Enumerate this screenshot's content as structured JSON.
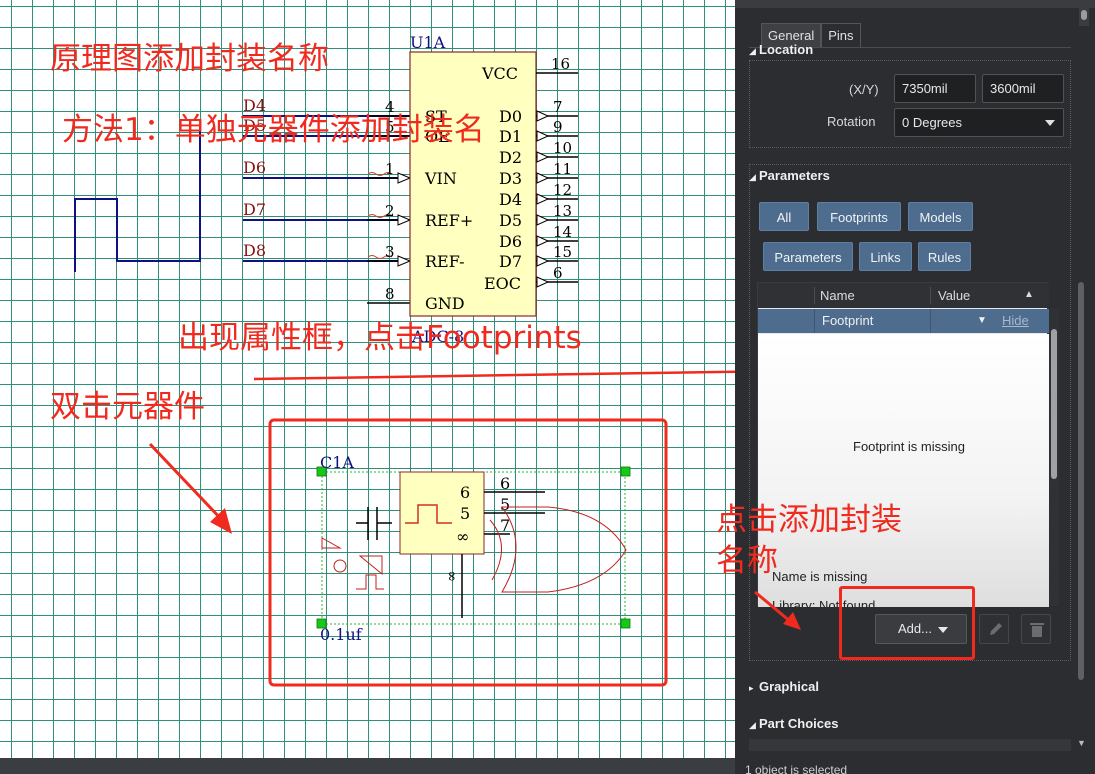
{
  "schematic": {
    "u1_designator": "U1A",
    "u1_comment": "ADC-8",
    "u1_left_pins": [
      {
        "name": "ST",
        "num": "4",
        "net": "D4"
      },
      {
        "name": "OE",
        "num": "5",
        "net": "D5"
      },
      {
        "name": "VIN",
        "num": "1",
        "net": "D6"
      },
      {
        "name": "REF+",
        "num": "2",
        "net": "D7"
      },
      {
        "name": "REF-",
        "num": "3",
        "net": "D8"
      },
      {
        "name": "GND",
        "num": "8",
        "net": ""
      }
    ],
    "u1_vcc": {
      "name": "VCC",
      "num": "16"
    },
    "u1_right_pins": [
      {
        "name": "D0",
        "num": "7"
      },
      {
        "name": "D1",
        "num": "9"
      },
      {
        "name": "D2",
        "num": "10"
      },
      {
        "name": "D3",
        "num": "11"
      },
      {
        "name": "D4",
        "num": "12"
      },
      {
        "name": "D5",
        "num": "13"
      },
      {
        "name": "D6",
        "num": "14"
      },
      {
        "name": "D7",
        "num": "15"
      },
      {
        "name": "EOC",
        "num": "6"
      }
    ],
    "c1_designator": "C1A",
    "c1_value": "0.1uf",
    "c1_pins": [
      "6",
      "5",
      "7"
    ],
    "c1_symbol": "∞"
  },
  "annotations": {
    "title": "原理图添加封装名称",
    "method": "方法1：单独元器件添加封装名",
    "property_box": "出现属性框，点击Footprints",
    "double_click": "双击元器件",
    "click_add_1": "点击添加封装",
    "click_add_2": "名称"
  },
  "panel": {
    "tabs": [
      "General",
      "Pins"
    ],
    "location": {
      "title": "Location",
      "xy_label": "(X/Y)",
      "x_value": "7350mil",
      "y_value": "3600mil",
      "rotation_label": "Rotation",
      "rotation_value": "0 Degrees"
    },
    "parameters": {
      "title": "Parameters",
      "filter_row1": [
        "All",
        "Footprints",
        "Models"
      ],
      "filter_row2": [
        "Parameters",
        "Links",
        "Rules"
      ],
      "col_name": "Name",
      "col_value": "Value",
      "row_name": "Footprint",
      "row_hide": "Hide",
      "missing_footprint": "Footprint is missing",
      "name_missing": "Name is missing",
      "library_not_found": "Library: Not found",
      "add_button": "Add..."
    },
    "graphical_title": "Graphical",
    "part_choices_title": "Part Choices",
    "status": "1 object is selected"
  },
  "colors": {
    "annotation": "#f02a1e",
    "grid": "#2f8f7a",
    "component_fill": "#ffffc0",
    "panel_bg": "#2b2d30",
    "accent_button": "#4e6c8e"
  }
}
